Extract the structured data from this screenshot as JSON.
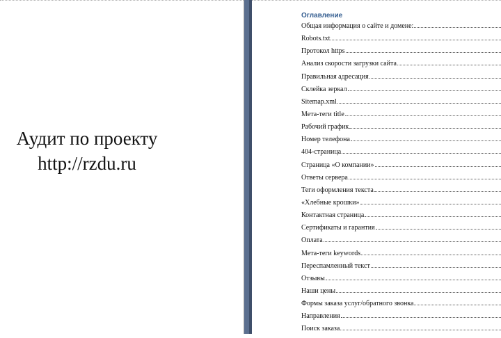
{
  "title_page": {
    "line1": "Аудит по проекту",
    "line2": "http://rzdu.ru"
  },
  "toc": {
    "heading": "Оглавление",
    "items": [
      "Общая информация о сайте и домене:",
      "Robots.txt",
      "Протокол https",
      "Анализ скорости загрузки сайта",
      "Правильная адресация",
      "Склейка зеркал",
      "Sitemap.xml",
      "Мета-теги title",
      "Рабочий график",
      "Номер телефона",
      "404-страница",
      "Страница «О компании»",
      "Ответы сервера",
      "Теги оформления текста",
      "«Хлебные крошки»",
      "Контактная страница",
      "Сертификаты и гарантия",
      "Оплата",
      "Мета-теги keywords",
      "Переспамленный текст",
      "Отзывы",
      "Наши цены",
      "Формы заказа услуг/обратного звонка",
      "Направления",
      "Поиск заказа"
    ]
  }
}
